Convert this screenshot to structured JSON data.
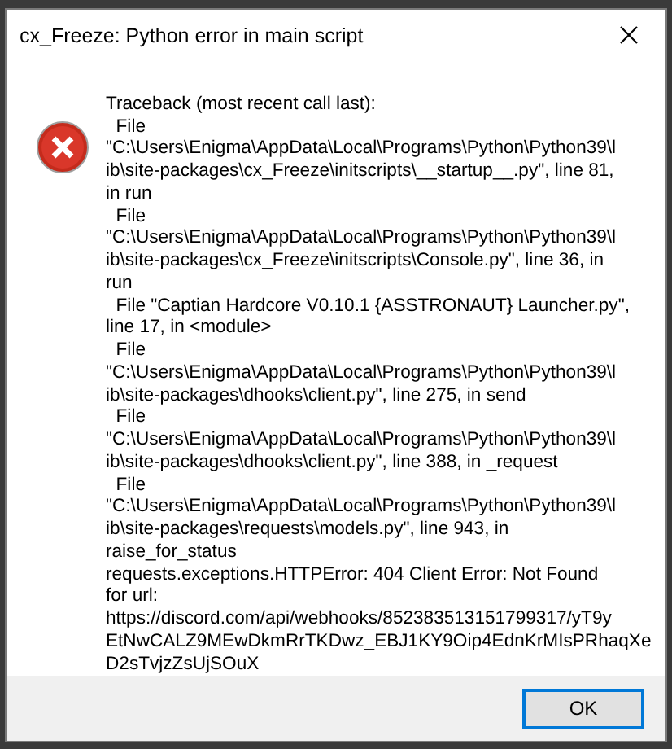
{
  "window": {
    "title": "cx_Freeze: Python error in main script"
  },
  "message": "Traceback (most recent call last):\n  File\n\"C:\\Users\\Enigma\\AppData\\Local\\Programs\\Python\\Python39\\l\nib\\site-packages\\cx_Freeze\\initscripts\\__startup__.py\", line 81,\nin run\n  File\n\"C:\\Users\\Enigma\\AppData\\Local\\Programs\\Python\\Python39\\l\nib\\site-packages\\cx_Freeze\\initscripts\\Console.py\", line 36, in\nrun\n  File \"Captian Hardcore V0.10.1 {ASSTRONAUT} Launcher.py\",\nline 17, in <module>\n  File\n\"C:\\Users\\Enigma\\AppData\\Local\\Programs\\Python\\Python39\\l\nib\\site-packages\\dhooks\\client.py\", line 275, in send\n  File\n\"C:\\Users\\Enigma\\AppData\\Local\\Programs\\Python\\Python39\\l\nib\\site-packages\\dhooks\\client.py\", line 388, in _request\n  File\n\"C:\\Users\\Enigma\\AppData\\Local\\Programs\\Python\\Python39\\l\nib\\site-packages\\requests\\models.py\", line 943, in\nraise_for_status\nrequests.exceptions.HTTPError: 404 Client Error: Not Found\nfor url:\nhttps://discord.com/api/webhooks/852383513151799317/yT9y\nEtNwCALZ9MEwDkmRrTKDwz_EBJ1KY9Oip4EdnKrMIsPRhaqXe\nD2sTvjzZsUjSOuX",
  "buttons": [
    {
      "label": "OK",
      "selected": true
    }
  ]
}
